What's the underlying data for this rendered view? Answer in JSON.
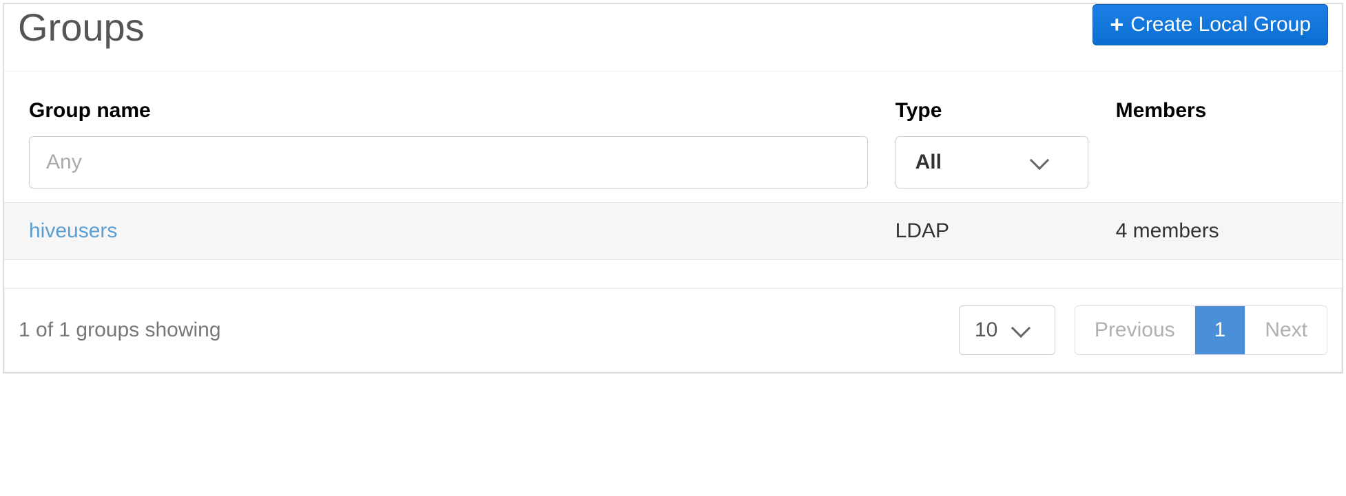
{
  "header": {
    "title": "Groups",
    "create_button_label": "Create Local Group"
  },
  "table": {
    "columns": {
      "group_name": "Group name",
      "type": "Type",
      "members": "Members"
    },
    "filters": {
      "group_name_placeholder": "Any",
      "type_selected": "All"
    },
    "rows": [
      {
        "name": "hiveusers",
        "type": "LDAP",
        "members": "4 members"
      }
    ]
  },
  "footer": {
    "status": "1 of 1 groups showing",
    "page_size": "10",
    "pager": {
      "previous": "Previous",
      "current": "1",
      "next": "Next"
    }
  }
}
